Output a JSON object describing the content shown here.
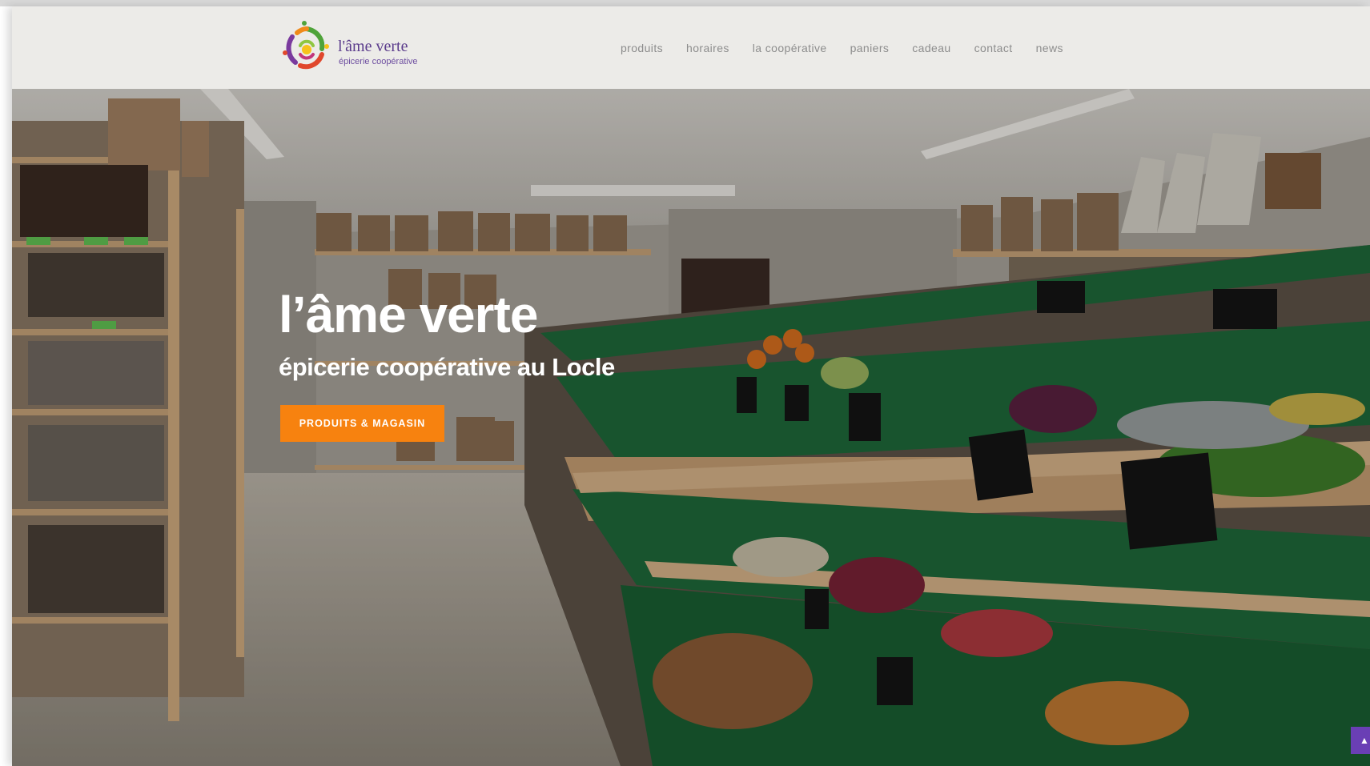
{
  "brand": {
    "name": "l'âme verte",
    "tagline": "épicerie coopérative"
  },
  "nav": {
    "items": [
      {
        "label": "produits"
      },
      {
        "label": "horaires"
      },
      {
        "label": "la coopérative"
      },
      {
        "label": "paniers"
      },
      {
        "label": "cadeau"
      },
      {
        "label": "contact"
      },
      {
        "label": "news"
      }
    ]
  },
  "hero": {
    "title": "l’âme verte",
    "subtitle": "épicerie coopérative au Locle",
    "cta_label": "PRODUITS & MAGASIN"
  },
  "icons": {
    "logo": "swirl-logo-icon",
    "scroll_top": "chevron-up-icon"
  },
  "colors": {
    "header_bg": "#ecebe8",
    "accent_orange": "#f7820f",
    "brand_purple": "#5b3c8c",
    "nav_text": "#8d8d8d",
    "scroll_button": "#6a3fb5"
  }
}
